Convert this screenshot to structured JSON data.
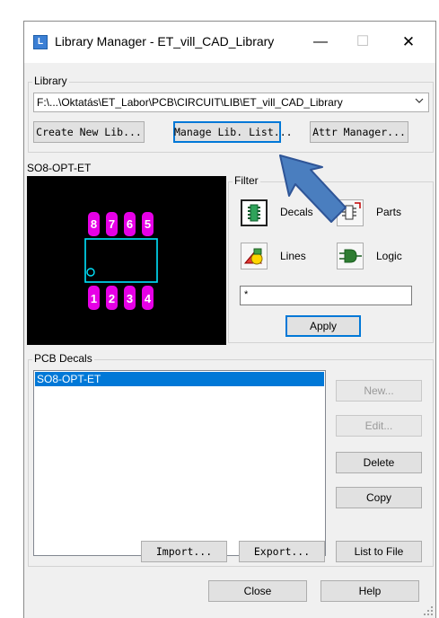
{
  "window": {
    "title": "Library Manager - ET_vill_CAD_Library",
    "icon_glyph": "L",
    "controls": {
      "minimize": "—",
      "maximize": "☐",
      "close": "✕"
    }
  },
  "library": {
    "group_label": "Library",
    "path": "F:\\...\\Oktatás\\ET_Labor\\PCB\\CIRCUIT\\LIB\\ET_vill_CAD_Library",
    "create_label": "Create New Lib...",
    "manage_label": "Manage Lib. List...",
    "attr_label": "Attr Manager..."
  },
  "preview": {
    "label": "SO8-OPT-ET",
    "pins_top": [
      "8",
      "7",
      "6",
      "5"
    ],
    "pins_bottom": [
      "1",
      "2",
      "3",
      "4"
    ],
    "colors": {
      "pad": "#e600e6",
      "outline": "#00e5ff",
      "background": "#000000",
      "pin_text": "#ffffff"
    }
  },
  "filter": {
    "group_label": "Filter",
    "decals_label": "Decals",
    "parts_label": "Parts",
    "lines_label": "Lines",
    "logic_label": "Logic",
    "pattern_value": "*",
    "apply_label": "Apply",
    "decals_icon": "decal-chip-icon",
    "parts_icon": "parts-icon",
    "lines_icon": "lines-shapes-icon",
    "logic_icon": "logic-gate-icon"
  },
  "decals": {
    "group_label": "PCB Decals",
    "items": [
      "SO8-OPT-ET"
    ],
    "new_label": "New...",
    "edit_label": "Edit...",
    "delete_label": "Delete",
    "copy_label": "Copy",
    "import_label": "Import...",
    "export_label": "Export...",
    "list_to_file_label": "List to File"
  },
  "footer": {
    "close_label": "Close",
    "help_label": "Help"
  },
  "colors": {
    "accent": "#0078d7",
    "arrow_fill": "#4a7ebf",
    "arrow_stroke": "#2f5597"
  }
}
